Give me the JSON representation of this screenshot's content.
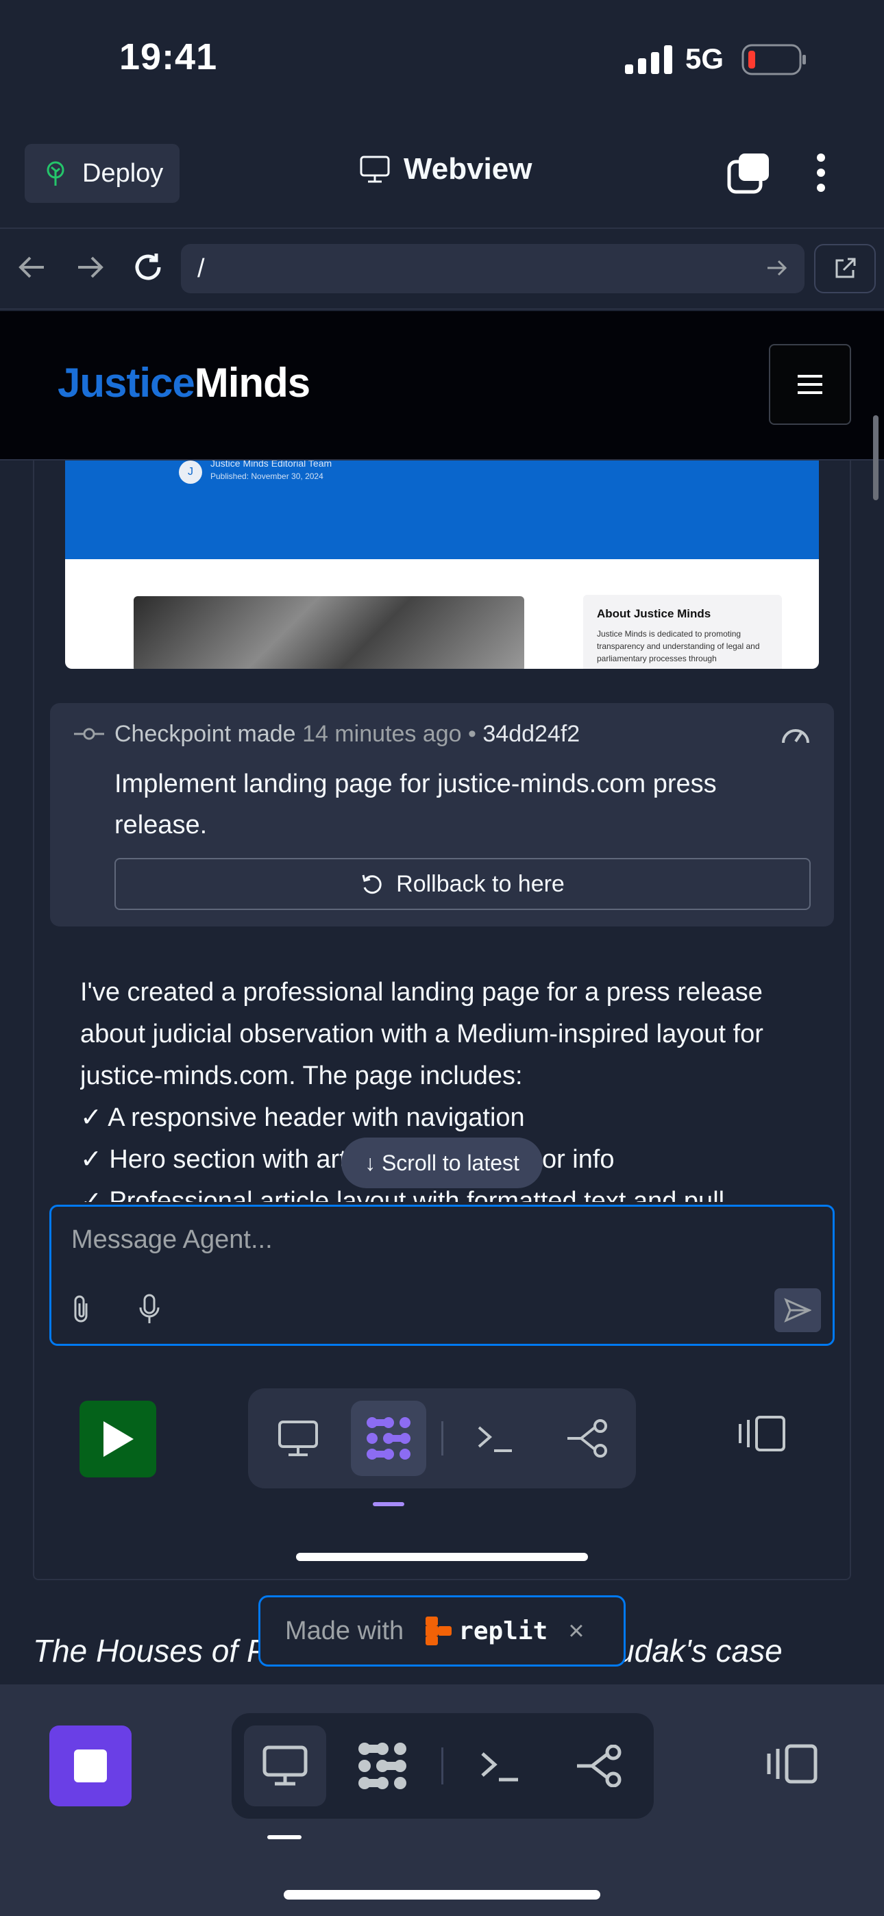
{
  "status_bar": {
    "time": "19:41",
    "network": "5G"
  },
  "top_bar": {
    "deploy_label": "Deploy",
    "title": "Webview"
  },
  "url_bar": {
    "path": "/"
  },
  "site": {
    "logo_part1": "Justice",
    "logo_part2": "Minds",
    "preview": {
      "avatar_letter": "J",
      "author": "Justice Minds Editorial Team",
      "date": "Published: November 30, 2024",
      "aside_title": "About Justice Minds",
      "aside_text": "Justice Minds is dedicated to promoting transparency and understanding of legal and parliamentary processes through"
    },
    "italic_text": "The Houses of Parliament reviewed Mr. Dudak's case"
  },
  "checkpoint": {
    "label": "Checkpoint made",
    "time": "14 minutes ago",
    "separator": "•",
    "hash": "34dd24f2",
    "description": "Implement landing page for justice-minds.com press release.",
    "rollback_label": "Rollback to here"
  },
  "agent_message": {
    "intro": "I've created a professional landing page for a press release about judicial observation with a Medium-inspired layout for justice-minds.com. The page includes:",
    "items": [
      "✓ A responsive header with navigation",
      "✓ Hero section with article title and author info",
      "✓ Professional article layout with formatted text and pull"
    ]
  },
  "scroll_latest_label": "↓ Scroll to latest",
  "input": {
    "placeholder": "Message Agent..."
  },
  "made_with": {
    "label": "Made with",
    "brand": "replit",
    "close": "×"
  },
  "colors": {
    "bg": "#1c2333",
    "surface": "#2b3245",
    "accent_blue": "#0079f2",
    "run_green": "#04621a",
    "stop_purple": "#6a3fe6",
    "logo_blue": "#1a6fd8"
  },
  "icons": {
    "deploy": "deploy-icon",
    "webview": "monitor-icon",
    "tabs": "tabs-icon",
    "more": "kebab-icon",
    "back": "arrow-left-icon",
    "forward": "arrow-right-icon",
    "reload": "reload-icon",
    "external": "external-link-icon",
    "menu": "hamburger-icon",
    "checkpoint": "commit-icon",
    "speed": "speedometer-icon",
    "rollback": "undo-icon",
    "attach": "paperclip-icon",
    "mic": "microphone-icon",
    "send": "send-icon",
    "run": "play-icon",
    "stop": "stop-icon",
    "agent": "agent-icon",
    "shell": "terminal-icon",
    "git": "git-icon",
    "dock": "dock-toggle-icon"
  }
}
